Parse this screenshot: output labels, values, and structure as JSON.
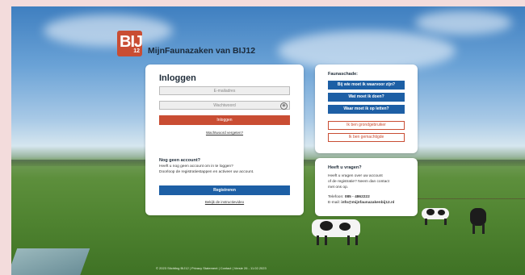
{
  "header": {
    "logo_text": "BIJ",
    "logo_sub": "12",
    "title": "MijnFaunazaken van BIJ12"
  },
  "login": {
    "title": "Inloggen",
    "email_placeholder": "E-mailadres",
    "password_placeholder": "Wachtwoord",
    "submit_label": "Inloggen",
    "forgot_link": "Wachtwoord vergeten?",
    "no_account_title": "Nog geen account?",
    "no_account_line1": "Heeft u nog geen account om in te loggen?",
    "no_account_line2": "Doorloop de registratiestappen en activeer uw account.",
    "register_label": "Registreren",
    "instruction_link": "Bekijk de instructievideo"
  },
  "fauna": {
    "title": "Faunaschade:",
    "buttons": [
      "Bij wie moet ik waarvoor zijn?",
      "Wat moet ik doen?",
      "Waar moet ik op letten?"
    ],
    "outline_buttons": [
      "Ik ben grondgebruiker",
      "Ik ben gemachtigde"
    ]
  },
  "help": {
    "title": "Heeft u vragen?",
    "line1": "Heeft u vragen over uw account",
    "line2": "of de registratie? Neem dan contact",
    "line3": "met ons op.",
    "phone_label": "Telefoon: ",
    "phone": "085 - 4862222",
    "email_label": "E-mail: ",
    "email": "info@mijnfaunazakenbij12.nl"
  },
  "footer": {
    "text": "© 2023 Stichting BIJ12 | Privacy Statement | Contact | Versie 26 - 11.02.2023"
  },
  "colors": {
    "accent_red": "#c94d33",
    "primary_blue": "#1d5fa5"
  }
}
